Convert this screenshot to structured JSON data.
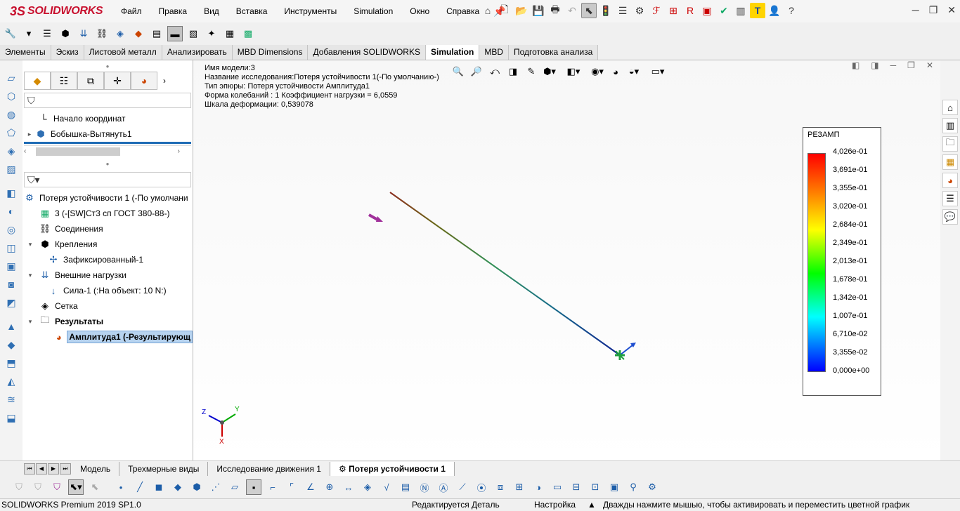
{
  "app": {
    "brand_ds": "3S",
    "brand": "SOLIDWORKS"
  },
  "menu": [
    "Файл",
    "Правка",
    "Вид",
    "Вставка",
    "Инструменты",
    "Simulation",
    "Окно",
    "Справка"
  ],
  "top_toolbar": {
    "icons": [
      "home-icon",
      "new-document-icon",
      "open-icon",
      "save-icon",
      "print-icon",
      "undo-icon",
      "select-icon",
      "rebuild-light-icon",
      "file-properties-icon",
      "options-gear-icon",
      "tool-icon",
      "tool-icon",
      "tool-icon",
      "tool-icon",
      "tool-icon",
      "tool-icon",
      "tool-icon",
      "user-icon",
      "help-icon",
      "search-icon"
    ]
  },
  "window_controls": {
    "minimize": "─",
    "restore": "❐",
    "close": "✕"
  },
  "command_tabs": [
    "Элементы",
    "Эскиз",
    "Листовой металл",
    "Анализировать",
    "MBD Dimensions",
    "Добавления SOLIDWORKS",
    "Simulation",
    "MBD",
    "Подготовка анализа"
  ],
  "active_command_tab": "Simulation",
  "feature_tree": [
    {
      "label": "Начало координат",
      "icon": "origin-icon",
      "expand": ""
    },
    {
      "label": "Бобышка-Вытянуть1",
      "icon": "extrude-boss-icon",
      "expand": "▸"
    }
  ],
  "study_tree": [
    {
      "label": "Потеря устойчивости 1 (-По умолчани",
      "icon": "buckling-study-icon",
      "expand": "",
      "indent": 0
    },
    {
      "label": "3 (-[SW]Ст3 сп ГОСТ 380-88-)",
      "icon": "part-material-icon",
      "expand": "",
      "indent": 1
    },
    {
      "label": "Соединения",
      "icon": "connections-icon",
      "expand": "",
      "indent": 1
    },
    {
      "label": "Крепления",
      "icon": "fixtures-icon",
      "expand": "▾",
      "indent": 1
    },
    {
      "label": "Зафиксированный-1",
      "icon": "fixed-geometry-icon",
      "expand": "",
      "indent": 2
    },
    {
      "label": "Внешние нагрузки",
      "icon": "external-loads-icon",
      "expand": "▾",
      "indent": 1
    },
    {
      "label": "Сила-1 (:На объект: 10 N:)",
      "icon": "force-arrow-icon",
      "expand": "",
      "indent": 2
    },
    {
      "label": "Сетка",
      "icon": "mesh-icon",
      "expand": "",
      "indent": 1
    },
    {
      "label": "Результаты",
      "icon": "results-folder-icon",
      "expand": "▾",
      "indent": 1,
      "bold": true
    },
    {
      "label": "Амплитуда1 (-Результирующ",
      "icon": "amplitude-plot-icon",
      "expand": "",
      "indent": 2,
      "selected": true
    }
  ],
  "info": {
    "line1": "Имя модели:3",
    "line2": "Название исследования:Потеря устойчивости 1(-По умолчанию-)",
    "line3": "Тип эпюры: Потеря устойчивости Амплитуда1",
    "line4": "Форма колебаний : 1  Коэффициент нагрузки =  6,0559",
    "line5": "Шкала деформации: 0,539078"
  },
  "legend": {
    "title": "РЕЗАМП",
    "labels": [
      "4,026e-01",
      "3,691e-01",
      "3,355e-01",
      "3,020e-01",
      "2,684e-01",
      "2,349e-01",
      "2,013e-01",
      "1,678e-01",
      "1,342e-01",
      "1,007e-01",
      "6,710e-02",
      "3,355e-02",
      "0,000e+00"
    ]
  },
  "triad": {
    "x": "X",
    "y": "Y",
    "z": "Z"
  },
  "bottom_tabs": [
    "Модель",
    "Трехмерные виды",
    "Исследование движения 1",
    "Потеря устойчивости 1"
  ],
  "active_bottom_tab": "Потеря устойчивости 1",
  "status": {
    "product": "SOLIDWORKS Premium 2019 SP1.0",
    "mode": "Редактируется Деталь",
    "settings": "Настройка",
    "hint": "Дважды нажмите мышью, чтобы активировать и переместить цветной график"
  }
}
